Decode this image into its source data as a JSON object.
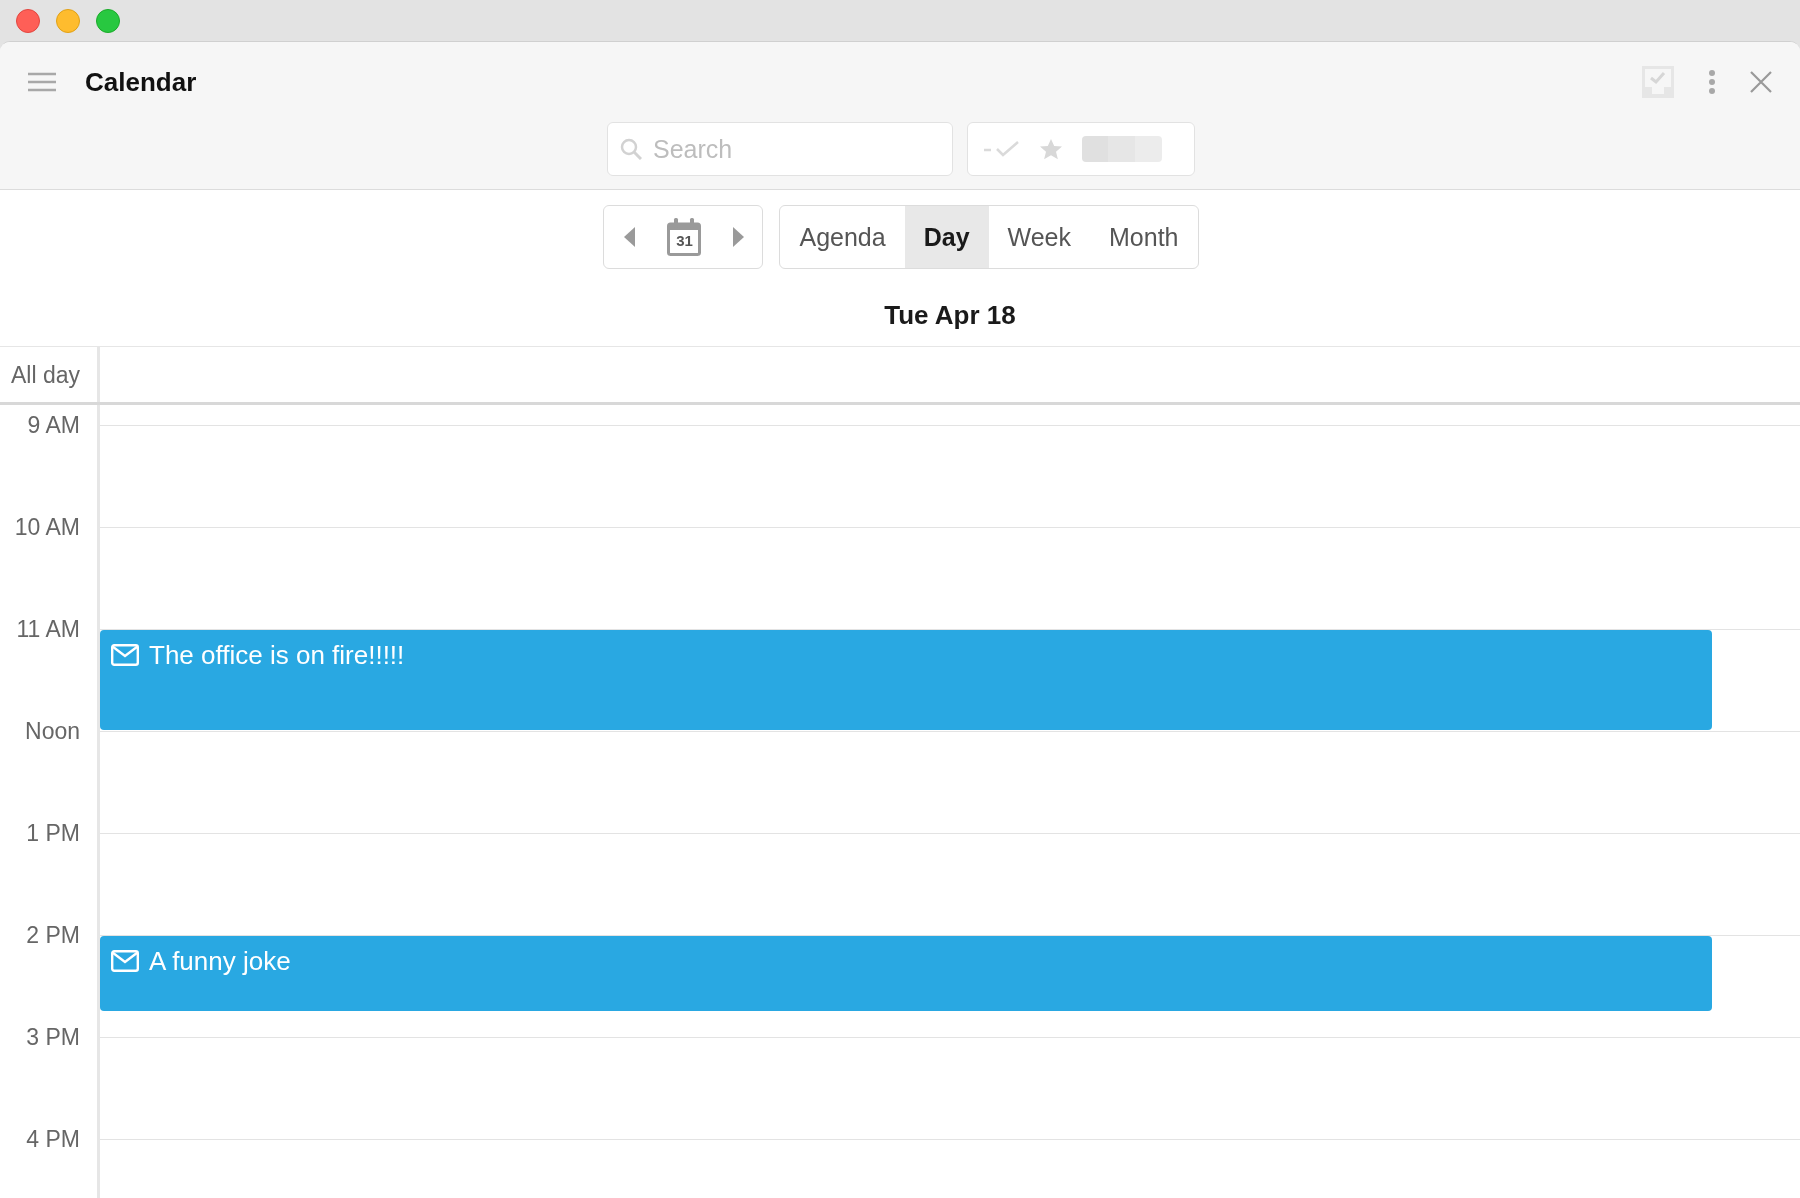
{
  "window": {
    "title": "Calendar"
  },
  "search": {
    "placeholder": "Search"
  },
  "nav": {
    "calendar_icon_day": "31"
  },
  "views": [
    {
      "label": "Agenda",
      "selected": false
    },
    {
      "label": "Day",
      "selected": true
    },
    {
      "label": "Week",
      "selected": false
    },
    {
      "label": "Month",
      "selected": false
    }
  ],
  "date_heading": "Tue Apr 18",
  "all_day": {
    "label": "All day"
  },
  "hours": [
    {
      "label": "9 AM"
    },
    {
      "label": "10 AM"
    },
    {
      "label": "11 AM",
      "events": [
        {
          "title": "The office is on fire!!!!!"
        }
      ]
    },
    {
      "label": "Noon"
    },
    {
      "label": "1 PM"
    },
    {
      "label": "2 PM",
      "events": [
        {
          "title": "A funny joke"
        }
      ]
    },
    {
      "label": "3 PM"
    },
    {
      "label": "4 PM"
    }
  ]
}
